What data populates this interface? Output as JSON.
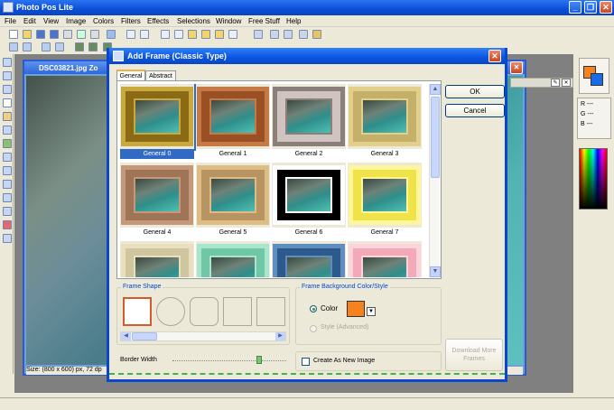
{
  "app": {
    "title": "Photo Pos Lite"
  },
  "menu": [
    "File",
    "Edit",
    "View",
    "Image",
    "Colors",
    "Filters",
    "Effects",
    "Selections",
    "Window",
    "Free Stuff",
    "Help"
  ],
  "image_window": {
    "title": "DSC03821.jpg  Zo",
    "status": "Size: (800 x 600) px, 72 dp"
  },
  "right_panel": {
    "r": "R ---",
    "g": "G ---",
    "b": "B ---"
  },
  "dialog": {
    "title": "Add Frame (Classic Type)",
    "tabs": [
      "General",
      "Abstract"
    ],
    "frames": [
      {
        "label": "General 0",
        "color": "#8a6a14",
        "inner": "#c9a93e",
        "selected": true
      },
      {
        "label": "General 1",
        "color": "#9b4f24",
        "inner": "#c57a45",
        "selected": false
      },
      {
        "label": "General 2",
        "color": "#cfc4c0",
        "inner": "#8b7f7c",
        "selected": false
      },
      {
        "label": "General 3",
        "color": "#c4b069",
        "inner": "#e1cf8b",
        "selected": false
      },
      {
        "label": "General 4",
        "color": "#a07456",
        "inner": "#c5987a",
        "selected": false
      },
      {
        "label": "General 5",
        "color": "#b79461",
        "inner": "#ddbd84",
        "selected": false
      },
      {
        "label": "General 6",
        "color": "#000000",
        "inner": "#ffffff",
        "selected": false
      },
      {
        "label": "General 7",
        "color": "#f0e34a",
        "inner": "#fff59a",
        "selected": false
      },
      {
        "label": "",
        "color": "#cfc6a0",
        "inner": "#e8e0bd",
        "selected": false
      },
      {
        "label": "",
        "color": "#6fc7a5",
        "inner": "#a9e5cd",
        "selected": false
      },
      {
        "label": "",
        "color": "#2d5a8c",
        "inner": "#5f8dbf",
        "selected": false
      },
      {
        "label": "",
        "color": "#f3a9b8",
        "inner": "#ffd3dc",
        "selected": false
      }
    ],
    "ok": "OK",
    "cancel": "Cancel",
    "frame_shape_label": "Frame Shape",
    "bg_label": "Frame Background Color/Style",
    "color_option": "Color",
    "style_option": "Style (Advanced)",
    "bg_color": "#f5821f",
    "download": "Download More Frames",
    "border_width": "Border Width",
    "create_new": "Create As New Image"
  }
}
